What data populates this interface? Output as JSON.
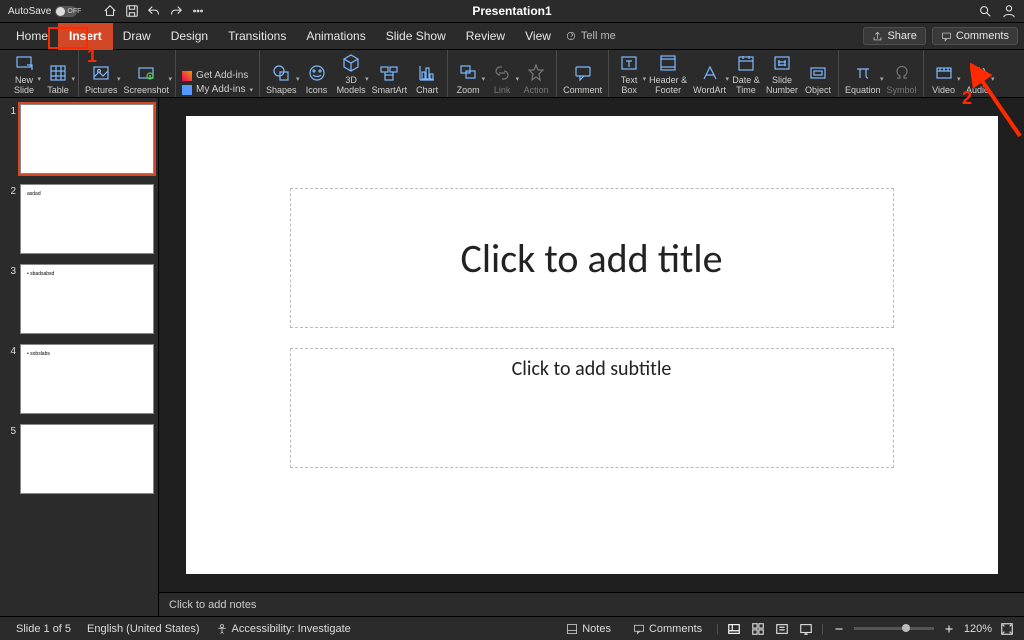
{
  "titlebar": {
    "autosave_label": "AutoSave",
    "autosave_state": "OFF",
    "doc_title": "Presentation1"
  },
  "tabs": {
    "items": [
      "Home",
      "Insert",
      "Draw",
      "Design",
      "Transitions",
      "Animations",
      "Slide Show",
      "Review",
      "View"
    ],
    "active_index": 1,
    "tell_me": "Tell me",
    "share": "Share",
    "comments": "Comments"
  },
  "ribbon": {
    "new_slide": "New\nSlide",
    "table": "Table",
    "pictures": "Pictures",
    "screenshot": "Screenshot",
    "get_addins": "Get Add-ins",
    "my_addins": "My Add-ins",
    "shapes": "Shapes",
    "icons": "Icons",
    "models3d": "3D\nModels",
    "smartart": "SmartArt",
    "chart": "Chart",
    "zoom": "Zoom",
    "link": "Link",
    "action": "Action",
    "comment": "Comment",
    "textbox": "Text\nBox",
    "headerfooter": "Header &\nFooter",
    "wordart": "WordArt",
    "datetime": "Date &\nTime",
    "slidenumber": "Slide\nNumber",
    "object": "Object",
    "equation": "Equation",
    "symbol": "Symbol",
    "video": "Video",
    "audio": "Audio"
  },
  "thumbs": {
    "count": 5,
    "selected": 1,
    "mini2": "asdad",
    "mini3": "• sbadsabsd",
    "mini4": "• sobslabs"
  },
  "slide": {
    "title_placeholder": "Click to add title",
    "subtitle_placeholder": "Click to add subtitle"
  },
  "notes_placeholder": "Click to add notes",
  "status": {
    "slide_info": "Slide 1 of 5",
    "language": "English (United States)",
    "accessibility": "Accessibility: Investigate",
    "notes": "Notes",
    "comments": "Comments",
    "zoom": "120%"
  },
  "annotations": {
    "num1": "1",
    "num2": "2"
  }
}
